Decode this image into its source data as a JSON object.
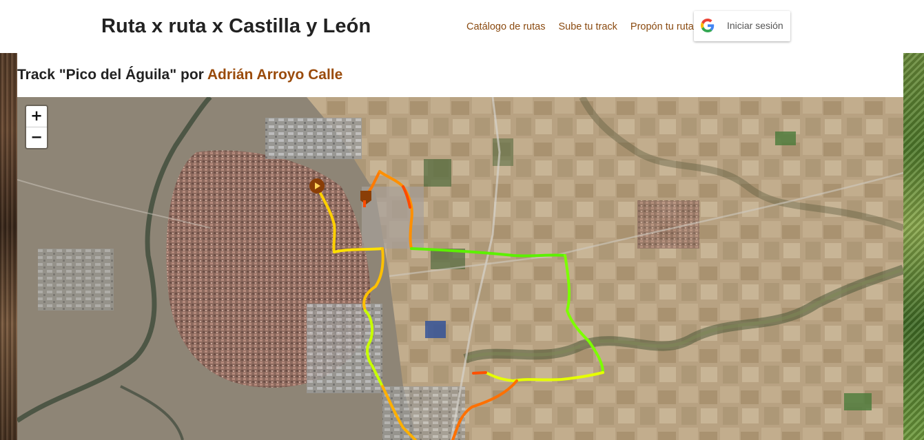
{
  "header": {
    "site_title": "Ruta x ruta x Castilla y León",
    "nav": [
      {
        "label": "Catálogo de rutas"
      },
      {
        "label": "Sube tu track"
      },
      {
        "label": "Propón tu ruta"
      }
    ],
    "login": {
      "label": "Iniciar sesión",
      "icon": "google-icon"
    }
  },
  "track": {
    "title_prefix": "Track \"Pico del Águila\" por ",
    "author": "Adrián Arroyo Calle"
  },
  "map": {
    "zoom_in_label": "+",
    "zoom_out_label": "−",
    "start_marker_icon": "play-icon",
    "end_marker_icon": "flag-icon",
    "route_gradient": [
      "#ff3a00",
      "#ffb300",
      "#f2ff00",
      "#6cff00",
      "#1ee81e"
    ]
  },
  "colors": {
    "accent": "#9a4b0b",
    "marker": "#8a3e07"
  }
}
